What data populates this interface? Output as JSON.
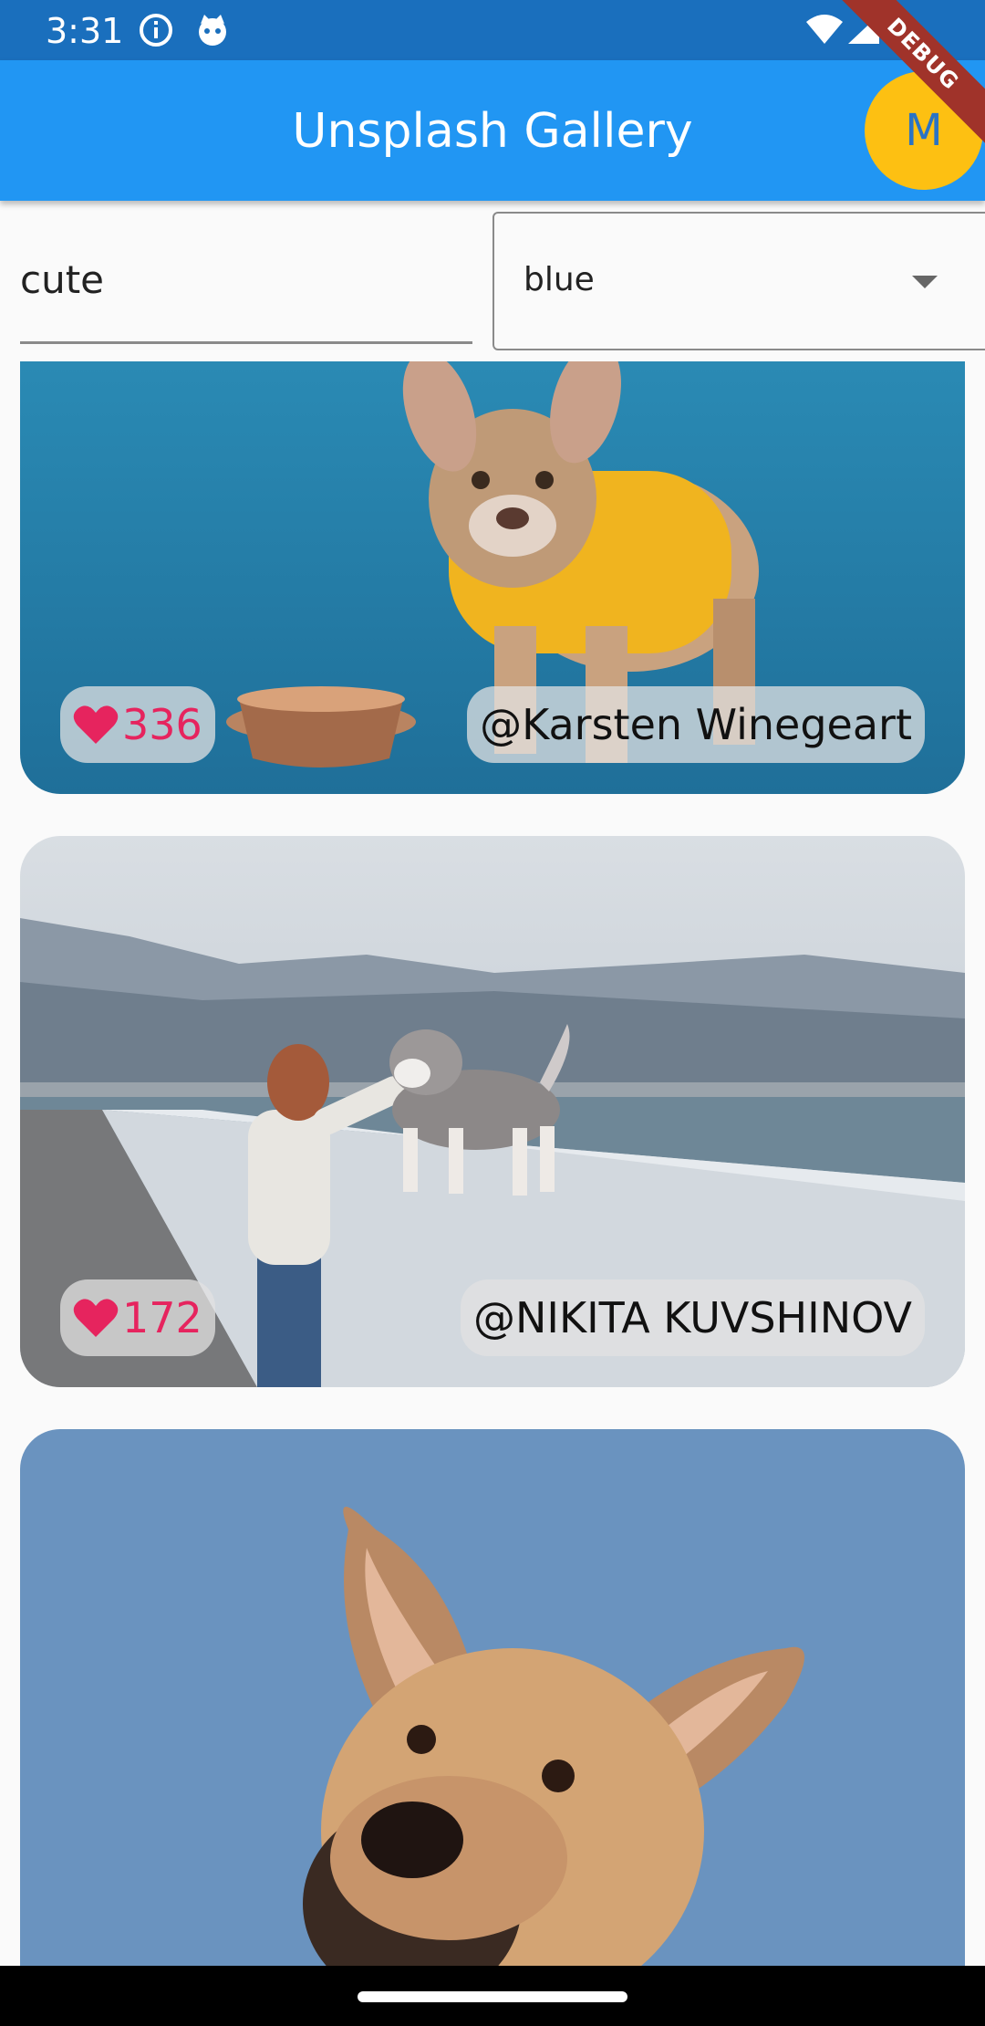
{
  "status_bar": {
    "time": "3:31",
    "icons": [
      "info-icon",
      "cat-icon",
      "wifi-icon",
      "signal-icon",
      "battery-icon"
    ]
  },
  "app_bar": {
    "title": "Unsplash Gallery",
    "avatar_initial": "M",
    "debug_banner": "DEBUG"
  },
  "filters": {
    "search_value": "cute",
    "color_value": "blue"
  },
  "photos": [
    {
      "likes": "336",
      "author": "@Karsten Winegeart"
    },
    {
      "likes": "172",
      "author": "@NIKITA KUVSHINOV"
    },
    {
      "likes": "",
      "author": ""
    }
  ],
  "colors": {
    "status_bar": "#1a6fbd",
    "app_bar": "#2196f3",
    "avatar": "#fdc012",
    "heart": "#e6245e"
  }
}
